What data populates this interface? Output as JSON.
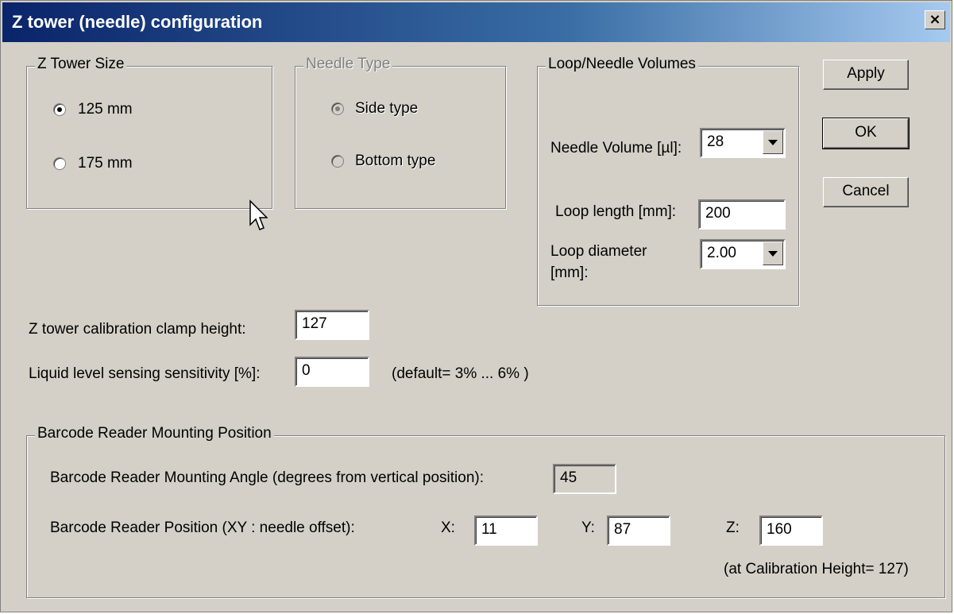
{
  "window": {
    "title": "Z tower (needle) configuration",
    "close_label": "×"
  },
  "tower_size": {
    "legend": "Z Tower Size",
    "options": [
      {
        "label": "125 mm",
        "selected": true
      },
      {
        "label": "175 mm",
        "selected": false
      }
    ]
  },
  "needle_type": {
    "legend": "Needle Type",
    "enabled": false,
    "options": [
      {
        "label": "Side type",
        "selected": true
      },
      {
        "label": "Bottom type",
        "selected": false
      }
    ]
  },
  "volumes": {
    "legend": "Loop/Needle Volumes",
    "needle_volume_label": "Needle Volume [µl]:",
    "needle_volume_value": "28",
    "loop_length_label": "Loop length [mm]:",
    "loop_length_value": "200",
    "loop_diameter_label_1": "Loop diameter",
    "loop_diameter_label_2": "[mm]:",
    "loop_diameter_value": "2.00"
  },
  "buttons": {
    "apply": "Apply",
    "ok": "OK",
    "cancel": "Cancel"
  },
  "clamp": {
    "label": "Z tower calibration clamp height:",
    "value": "127"
  },
  "sensitivity": {
    "label": "Liquid level sensing sensitivity [%]:",
    "value": "0",
    "hint": "(default= 3% ... 6% )"
  },
  "barcode": {
    "legend": "Barcode Reader Mounting Position",
    "angle_label": "Barcode Reader Mounting Angle (degrees from vertical position):",
    "angle_value": "45",
    "position_label": "Barcode Reader Position (XY : needle offset):",
    "x_label": "X:",
    "x_value": "11",
    "y_label": "Y:",
    "y_value": "87",
    "z_label": "Z:",
    "z_value": "160",
    "note": "(at Calibration Height= 127)"
  }
}
